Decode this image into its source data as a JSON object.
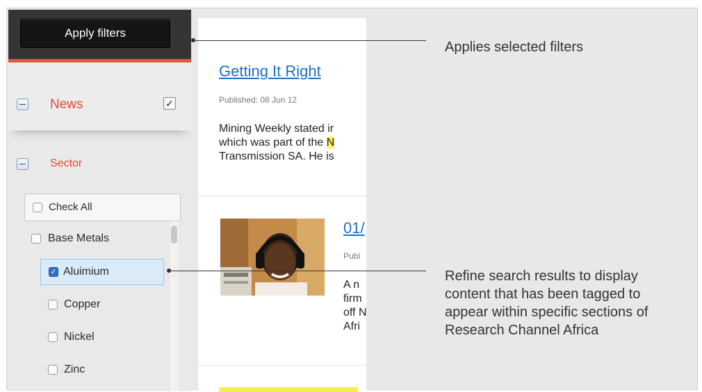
{
  "sidebar": {
    "apply_label": "Apply filters",
    "news_label": "News",
    "news_checked": true,
    "sector_label": "Sector",
    "check_all_label": "Check All",
    "options": [
      {
        "label": "Base Metals",
        "checked": false
      },
      {
        "label": "Aluimium",
        "checked": true
      },
      {
        "label": "Copper",
        "checked": false
      },
      {
        "label": "Nickel",
        "checked": false
      },
      {
        "label": "Zinc",
        "checked": false
      }
    ]
  },
  "articles": [
    {
      "title": "Getting It Right",
      "published": "Published: 08 Jun 12",
      "lines": [
        "Mining Weekly stated ir",
        "which was part of the ",
        "Transmission SA. He is"
      ],
      "highlight": "N"
    },
    {
      "title": "01/",
      "published": "Publ",
      "lines": [
        "A n",
        "firm",
        "off N",
        "Afri"
      ]
    }
  ],
  "callouts": {
    "apply": "Applies selected filters",
    "refine": [
      "Refine search results to display",
      "content that has been tagged to",
      "appear within specific sections of",
      "Research Channel Africa"
    ]
  },
  "colors": {
    "accent_red": "#e24b31",
    "link_blue": "#1a6fc9",
    "highlight_yellow": "#fbf25a"
  }
}
